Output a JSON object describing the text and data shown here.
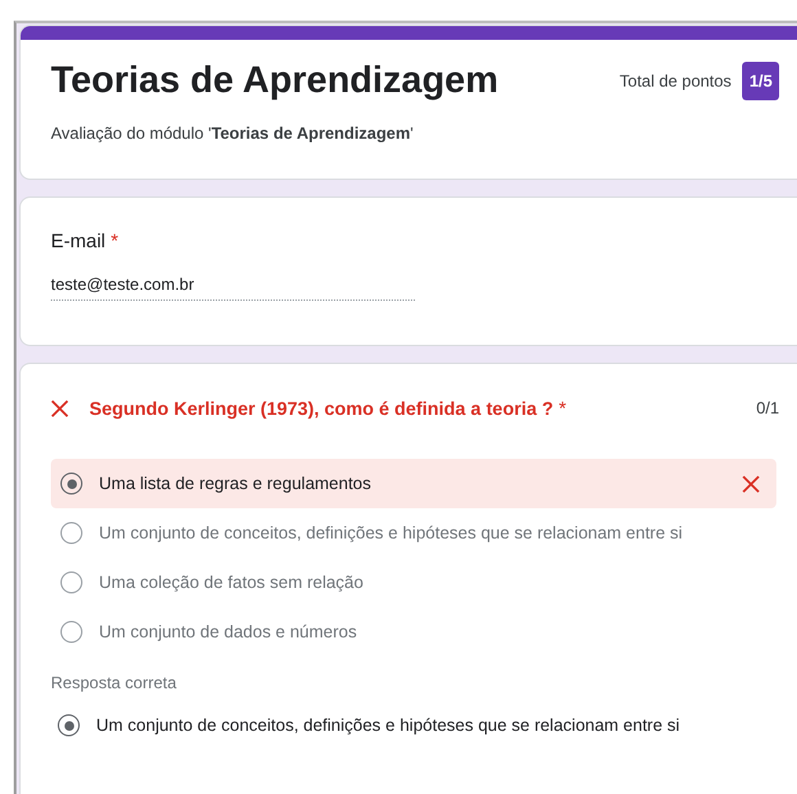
{
  "header": {
    "title": "Teorias de Aprendizagem",
    "description": "Avaliação do módulo '**Teorias de Aprendizagem**'",
    "points_label": "Total de pontos",
    "points": "1/5"
  },
  "email": {
    "label": "E-mail",
    "required_mark": "*",
    "value": "teste@teste.com.br"
  },
  "question": {
    "correct": false,
    "text": "Segundo Kerlinger (1973), como é definida a teoria ?",
    "required_mark": "*",
    "score": "0/1",
    "options": [
      {
        "label": "Uma lista de regras e regulamentos",
        "selected": true,
        "marked_wrong": true
      },
      {
        "label": "Um conjunto de conceitos, definições e hipóteses que se relacionam entre si",
        "selected": false,
        "marked_wrong": false
      },
      {
        "label": "Uma coleção de fatos sem relação",
        "selected": false,
        "marked_wrong": false
      },
      {
        "label": "Um conjunto de dados e números",
        "selected": false,
        "marked_wrong": false
      }
    ],
    "correct_answer": {
      "label": "Resposta correta",
      "option": {
        "label": "Um conjunto de conceitos, definições e hipóteses que se relacionam entre si",
        "selected": true
      }
    }
  }
}
